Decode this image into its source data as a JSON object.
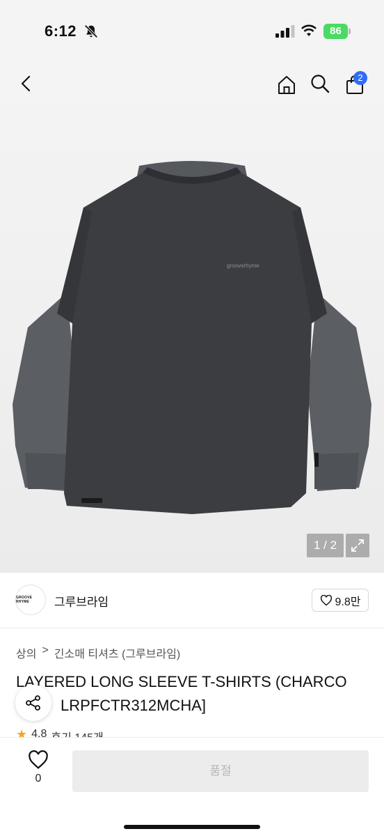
{
  "status_bar": {
    "time": "6:12",
    "battery": "86"
  },
  "nav": {
    "cart_count": "2"
  },
  "gallery": {
    "counter": "1 / 2",
    "print_text": "grooverhyme"
  },
  "brand": {
    "logo_text": "GROOVE RHYME",
    "name": "그루브라임",
    "likes": "9.8만"
  },
  "breadcrumb": {
    "level1": "상의",
    "separator": ">",
    "level2": "긴소매 티셔츠 (그루브라임)"
  },
  "product": {
    "title_line1": "LAYERED LONG SLEEVE T-SHIRTS (CHARCO",
    "title_line2": "LRPFCTR312MCHA]",
    "rating": "4.8",
    "reviews": "후기 145개"
  },
  "bottom_bar": {
    "heart_count": "0",
    "soldout_label": "품절"
  },
  "colors": {
    "accent": "#2f6df6",
    "battery": "#4cd964",
    "shirt": "#3b3d40",
    "sleeve": "#5b5e62"
  }
}
